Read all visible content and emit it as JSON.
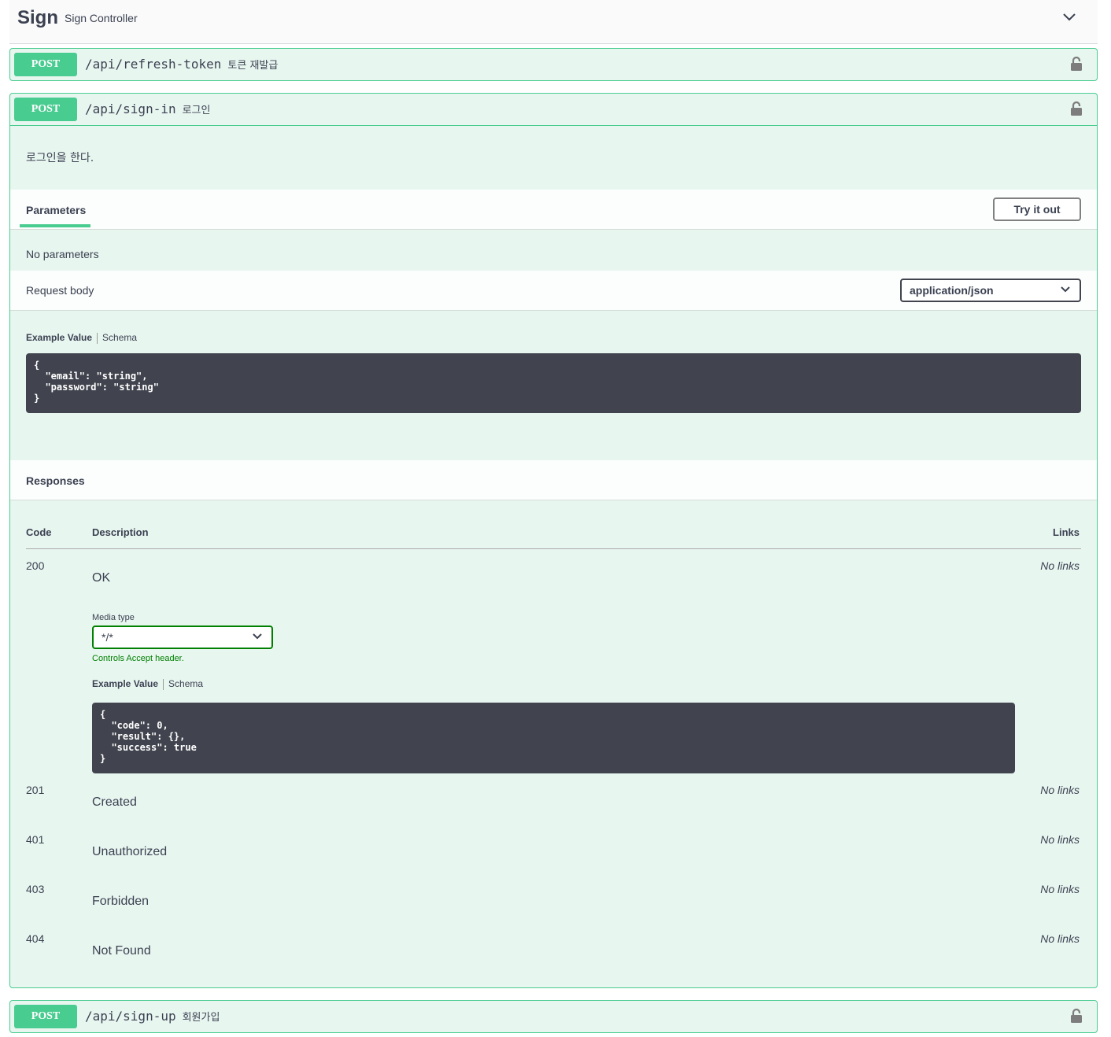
{
  "tag": {
    "name": "Sign",
    "description": "Sign Controller"
  },
  "operations": [
    {
      "method": "POST",
      "path": "/api/refresh-token",
      "summary": "토큰 재발급"
    },
    {
      "method": "POST",
      "path": "/api/sign-in",
      "summary": "로그인"
    },
    {
      "method": "POST",
      "path": "/api/sign-up",
      "summary": "회원가입"
    }
  ],
  "signin": {
    "description": "로그인을 한다.",
    "parameters_tab": "Parameters",
    "try_it_out": "Try it out",
    "no_parameters": "No parameters",
    "request_body_label": "Request body",
    "request_content_type": "application/json",
    "example_value_tab": "Example Value",
    "schema_tab": "Schema",
    "request_example": "{\n  \"email\": \"string\",\n  \"password\": \"string\"\n}",
    "responses_title": "Responses",
    "col_code": "Code",
    "col_description": "Description",
    "col_links": "Links",
    "media_type_label": "Media type",
    "media_type_value": "*/*",
    "media_type_hint": "Controls Accept header.",
    "response_example": "{\n  \"code\": 0,\n  \"result\": {},\n  \"success\": true\n}",
    "responses": [
      {
        "code": "200",
        "description": "OK",
        "links": "No links"
      },
      {
        "code": "201",
        "description": "Created",
        "links": "No links"
      },
      {
        "code": "401",
        "description": "Unauthorized",
        "links": "No links"
      },
      {
        "code": "403",
        "description": "Forbidden",
        "links": "No links"
      },
      {
        "code": "404",
        "description": "Not Found",
        "links": "No links"
      }
    ]
  },
  "colors": {
    "post": "#49cc90",
    "post_bg": "#e8f6f0",
    "code_bg": "#41444e"
  },
  "icons": {
    "lock": "lock-icon",
    "collapse": "chevron-down-icon"
  }
}
